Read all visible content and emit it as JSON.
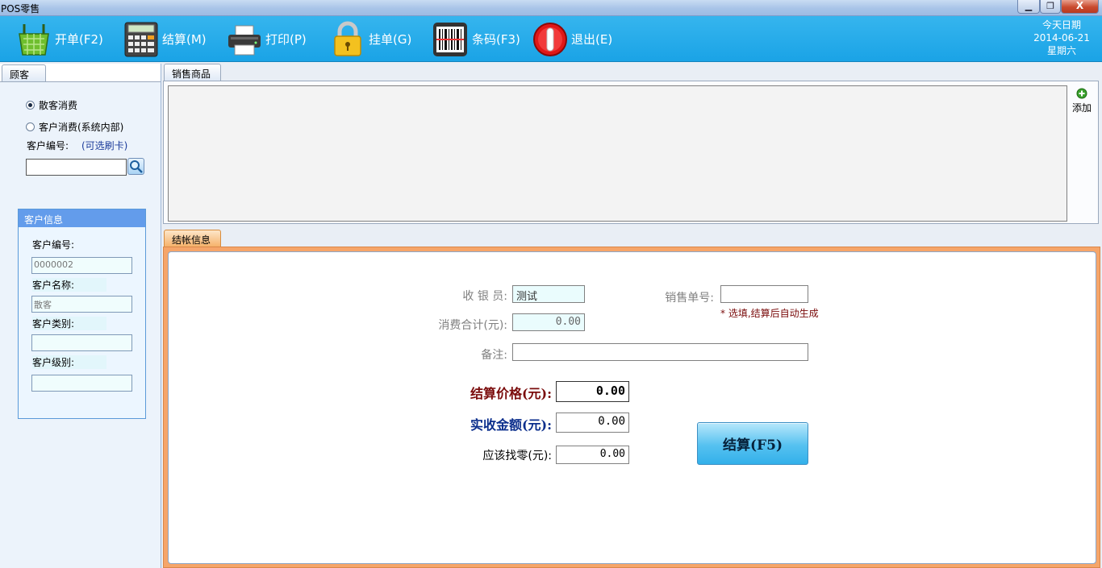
{
  "window": {
    "title": "POS零售",
    "min_label": "▁",
    "max_label": "❐",
    "close_label": "X"
  },
  "toolbar": {
    "items": [
      {
        "label": "开单(F2)",
        "icon": "basket-icon"
      },
      {
        "label": "结算(M)",
        "icon": "calculator-icon"
      },
      {
        "label": "打印(P)",
        "icon": "printer-icon"
      },
      {
        "label": "挂单(G)",
        "icon": "lock-icon"
      },
      {
        "label": "条码(F3)",
        "icon": "barcode-icon"
      },
      {
        "label": "退出(E)",
        "icon": "power-icon"
      }
    ],
    "date": {
      "label": "今天日期",
      "value": "2014-06-21",
      "weekday": "星期六"
    }
  },
  "customer_panel": {
    "tab_label": "顾客",
    "radio_walkin": "散客消费",
    "radio_member": "客户消费(系统内部)",
    "id_label": "客户编号:",
    "id_hint": "(可选刷卡)",
    "id_input_value": "",
    "info": {
      "title": "客户信息",
      "id_label": "客户编号:",
      "id_value": "0000002",
      "name_label": "客户名称:",
      "name_value": "散客",
      "type_label": "客户类别:",
      "type_value": "",
      "level_label": "客户级别:",
      "level_value": ""
    }
  },
  "sales_panel": {
    "tab_label": "销售商品",
    "add_label": "添加"
  },
  "settle_panel": {
    "tab_label": "结帐信息",
    "cashier_label": "收 银 员:",
    "cashier_value": "测试",
    "order_label": "销售单号:",
    "order_value": "",
    "order_hint": "* 选填,结算后自动生成",
    "total_label": "消费合计(元):",
    "total_value": "0.00",
    "remark_label": "备注:",
    "remark_value": "",
    "price_label": "结算价格(元):",
    "price_value": "0.00",
    "received_label": "实收金额(元):",
    "received_value": "0.00",
    "change_label": "应该找零(元):",
    "change_value": "0.00",
    "settle_button": "结算(F5)"
  },
  "colors": {
    "toolbar": "#1aa3e6",
    "price_label": "#7a0b0b",
    "received_label": "#0b2e8c",
    "hint": "#7a0b0b",
    "settle_frame": "#f6a569"
  }
}
